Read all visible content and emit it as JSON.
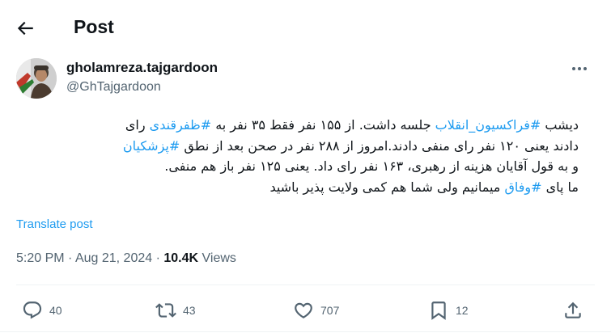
{
  "header": {
    "title": "Post",
    "back_icon": "arrow-left-icon"
  },
  "author": {
    "display_name": "gholamreza.tajgardoon",
    "handle": "@GhTajgardoon"
  },
  "post": {
    "lines": [
      [
        {
          "t": "دیشب "
        },
        {
          "t": "#فراکسیون_انقلاب",
          "tag": true
        },
        {
          "t": " جلسه داشت. از ۱۵۵ نفر فقط ۳۵ نفر به "
        },
        {
          "t": "#ظفرقندی",
          "tag": true
        },
        {
          "t": " رای"
        }
      ],
      [
        {
          "t": "دادند یعنی ۱۲۰ نفر رای منفی دادند.امروز از ۲۸۸ نفر در صحن بعد از نطق "
        },
        {
          "t": "#پزشکیان",
          "tag": true
        }
      ],
      [
        {
          "t": "و به قول آقایان هزینه از رهبری، ۱۶۳ نفر رای داد. یعنی ۱۲۵ نفر باز هم منفی."
        }
      ],
      [
        {
          "t": "ما پای "
        },
        {
          "t": "#وفاق",
          "tag": true
        },
        {
          "t": " میمانیم ولی شما هم کمی ولایت پذیر باشید"
        }
      ]
    ],
    "translate_label": "Translate post"
  },
  "meta": {
    "time": "5:20 PM",
    "date": "Aug 21, 2024",
    "separator": "·",
    "views_count": "10.4K",
    "views_label": "Views"
  },
  "actions": {
    "replies": "40",
    "reposts": "43",
    "likes": "707",
    "bookmarks": "12"
  },
  "colors": {
    "accent": "#1d9bf0",
    "text": "#0f1419",
    "secondary": "#536471"
  }
}
